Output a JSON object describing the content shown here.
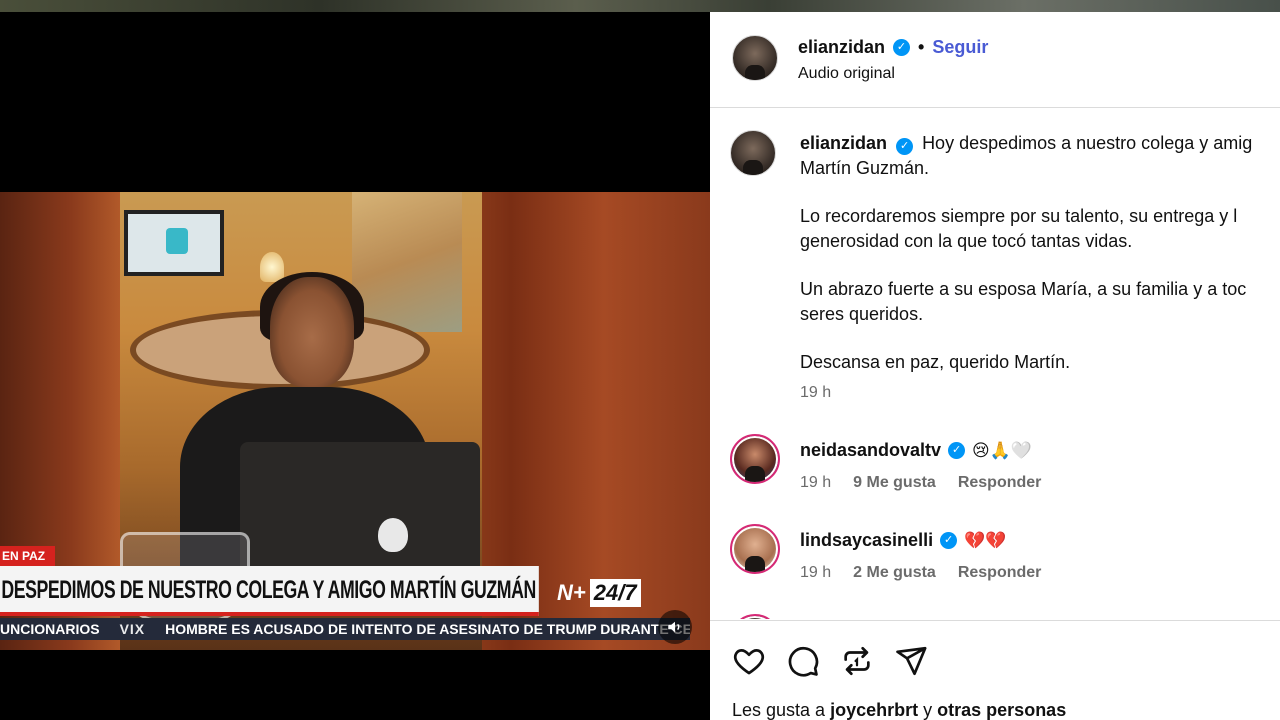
{
  "video": {
    "lower_third_tag": "EN PAZ",
    "headline": "DESPEDIMOS DE NUESTRO COLEGA Y AMIGO MARTÍN GUZMÁN",
    "brand_n": "N+",
    "brand_247": "24/7",
    "ticker_left": "UNCIONARIOS",
    "ticker_vix": "VIX",
    "ticker_right": "HOMBRE ES ACUSADO DE INTENTO DE ASESINATO DE TRUMP DURANTE CENA",
    "mute_icon": "speaker-icon"
  },
  "post_header": {
    "username": "elianzidan",
    "separator": "•",
    "follow_label": "Seguir",
    "audio_label": "Audio original"
  },
  "caption": {
    "username": "elianzidan",
    "line1": "Hoy despedimos a nuestro colega y amig",
    "line2": "Martín Guzmán.",
    "para2_line1": "Lo recordaremos siempre por su talento, su entrega y l",
    "para2_line2": "generosidad con la que tocó tantas vidas.",
    "para3_line1": "Un abrazo fuerte a su esposa María, a su familia y a toc",
    "para3_line2": "seres queridos.",
    "para4": "Descansa en paz, querido Martín.",
    "time": "19 h"
  },
  "comments": [
    {
      "username": "neidasandovaltv",
      "text": "😢🙏🤍",
      "time": "19 h",
      "likes": "9 Me gusta",
      "reply": "Responder"
    },
    {
      "username": "lindsaycasinelli",
      "text": "💔💔",
      "time": "19 h",
      "likes": "2 Me gusta",
      "reply": "Responder"
    }
  ],
  "actions": {
    "like_icon": "heart-icon",
    "comment_icon": "comment-icon",
    "repost_icon": "repost-icon",
    "share_icon": "send-icon",
    "likes_prefix": "Les gusta a",
    "likes_user": "joycehrbrt",
    "likes_middle": "y",
    "likes_suffix": "otras personas"
  },
  "colors": {
    "follow": "#4a5bd4",
    "verified": "#0095f6",
    "headline_bar": "#d5221e"
  }
}
